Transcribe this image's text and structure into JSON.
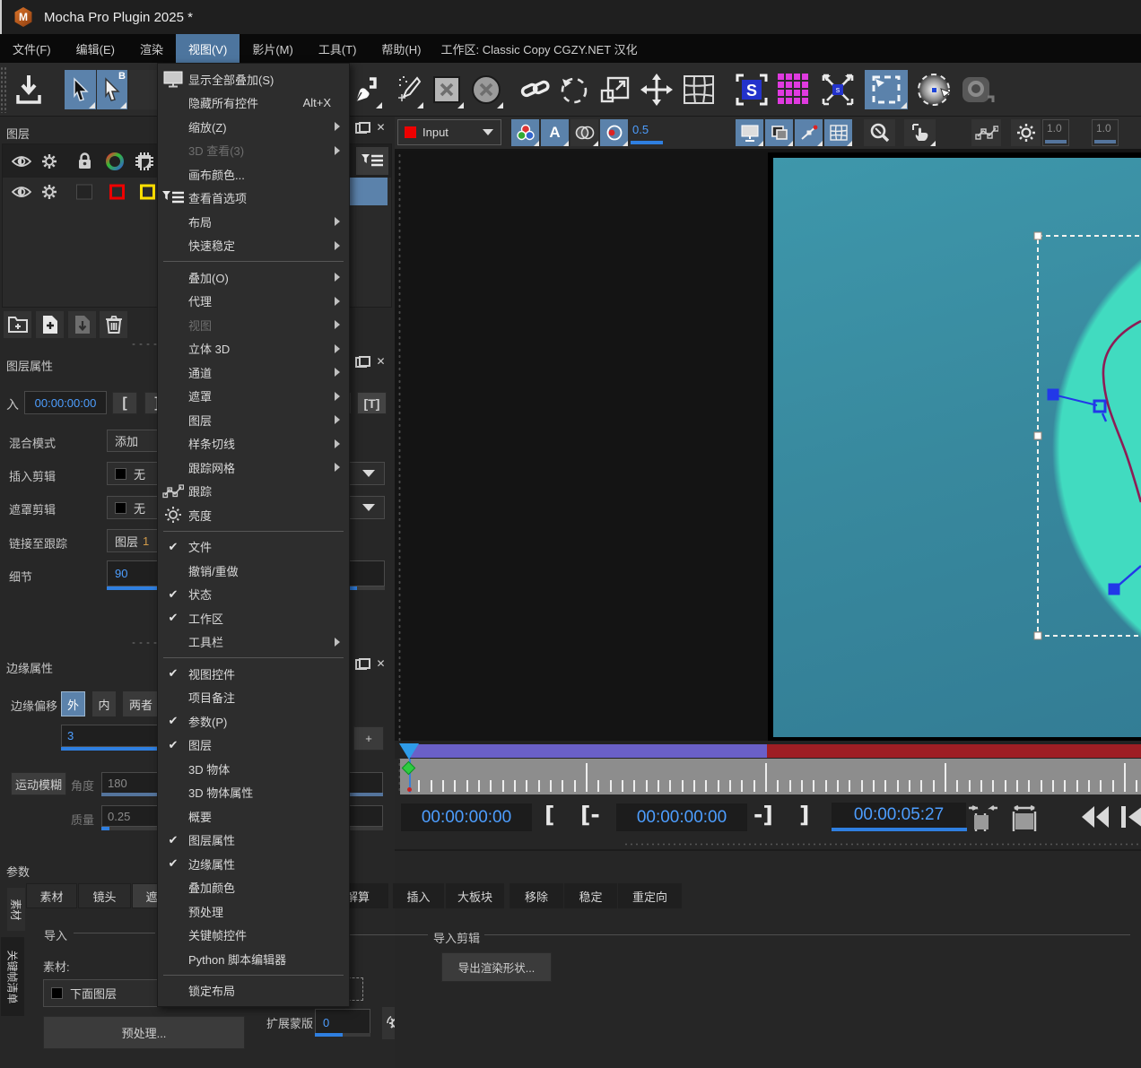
{
  "window": {
    "title": "Mocha Pro Plugin 2025 *",
    "logo": "M"
  },
  "menubar": {
    "items": [
      "文件(F)",
      "编辑(E)",
      "渲染",
      "视图(V)",
      "影片(M)",
      "工具(T)",
      "帮助(H)"
    ],
    "active_item": "视图(V)",
    "workspace_label": "工作区: Classic Copy  CGZY.NET 汉化"
  },
  "view_menu": {
    "items": [
      {
        "label": "显示全部叠加(S)",
        "icon": "monitor-icon"
      },
      {
        "label": "隐藏所有控件",
        "shortcut": "Alt+X"
      },
      {
        "label": "缩放(Z)",
        "submenu": true
      },
      {
        "label": "3D 查看(3)",
        "submenu": true,
        "disabled": true
      },
      {
        "label": "画布颜色..."
      },
      {
        "label": "查看首选项",
        "icon": "view-prefs-icon"
      },
      {
        "label": "布局",
        "submenu": true
      },
      {
        "label": "快速稳定",
        "submenu": true
      },
      {
        "sep": true
      },
      {
        "label": "叠加(O)",
        "submenu": true
      },
      {
        "label": "代理",
        "submenu": true
      },
      {
        "label": "视图",
        "submenu": true,
        "disabled": true
      },
      {
        "label": "立体 3D",
        "submenu": true
      },
      {
        "label": "通道",
        "submenu": true
      },
      {
        "label": "遮罩",
        "submenu": true
      },
      {
        "label": "图层",
        "submenu": true
      },
      {
        "label": "样条切线",
        "submenu": true
      },
      {
        "label": "跟踪网格",
        "submenu": true
      },
      {
        "label": "跟踪",
        "icon": "track-icon"
      },
      {
        "label": "亮度",
        "icon": "brightness-icon"
      },
      {
        "sep": true
      },
      {
        "label": "文件",
        "checked": true
      },
      {
        "label": "撤销/重做"
      },
      {
        "label": "状态",
        "checked": true
      },
      {
        "label": "工作区",
        "checked": true
      },
      {
        "label": "工具栏",
        "submenu": true
      },
      {
        "sep": true
      },
      {
        "label": "视图控件",
        "checked": true
      },
      {
        "label": "项目备注"
      },
      {
        "label": "参数(P)",
        "checked": true
      },
      {
        "label": "图层",
        "checked": true
      },
      {
        "label": "3D 物体"
      },
      {
        "label": "3D 物体属性"
      },
      {
        "label": "概要"
      },
      {
        "label": "图层属性",
        "checked": true
      },
      {
        "label": "边缘属性",
        "checked": true
      },
      {
        "label": "叠加颜色"
      },
      {
        "label": "预处理"
      },
      {
        "label": "关键帧控件"
      },
      {
        "label": "Python 脚本编辑器"
      },
      {
        "sep": true
      },
      {
        "label": "锁定布局"
      }
    ]
  },
  "toolbar": {
    "cursor_b_label": "B",
    "stabilize_letter": "S",
    "clip_selector_value": "Input",
    "workspace_selector_value": "Classic Copy",
    "overlay_opacity": "0.5",
    "exposure": "1.0",
    "gamma": "1.0"
  },
  "layers_panel": {
    "title": "图层"
  },
  "layer_props": {
    "title": "图层属性",
    "in_label": "入",
    "in_value": "00:00:00:00",
    "bracket_open": "[",
    "bracket_close": "]",
    "t_button": "[T]",
    "blend_label": "混合模式",
    "blend_value": "添加",
    "insert_label": "插入剪辑",
    "insert_value": "无",
    "matte_label": "遮罩剪辑",
    "matte_value": "无",
    "link_label": "链接至跟踪",
    "link_value": "图层",
    "link_num": "1",
    "detail_label": "细节",
    "detail_value": "90"
  },
  "edge_props": {
    "title": "边缘属性",
    "offset_label": "边缘偏移",
    "btn_out": "外",
    "btn_in": "内",
    "btn_both": "两者",
    "width_value": "3",
    "plus_btn": "+",
    "motion_blur": "运动模糊",
    "angle_label": "角度",
    "angle_value": "180",
    "quality_label": "质量",
    "quality_value": "0.25"
  },
  "params_section": {
    "title": "参数",
    "vtab1": "素材",
    "vtab2": "关键帧清单",
    "tabs": [
      "素材",
      "镜头",
      "遮罩"
    ],
    "import_header": "导入",
    "clip_label": "素材:",
    "layer_below_value": "下面图层",
    "preprocess_btn": "预处理...",
    "expand_mask_label": "扩展蒙版",
    "expand_mask_value": "0"
  },
  "bottom_right": {
    "tabs": [
      "机解算",
      "插入",
      "大板块",
      "移除",
      "稳定",
      "重定向"
    ],
    "import_clip_header": "导入剪辑",
    "export_btn": "导出渲染形状..."
  },
  "timeline": {
    "tc_in": "00:00:00:00",
    "tc_current": "00:00:00:00",
    "tc_out": "00:00:05:27",
    "b1": "[",
    "b2": "[-",
    "b3": "-]",
    "b4": "]"
  }
}
